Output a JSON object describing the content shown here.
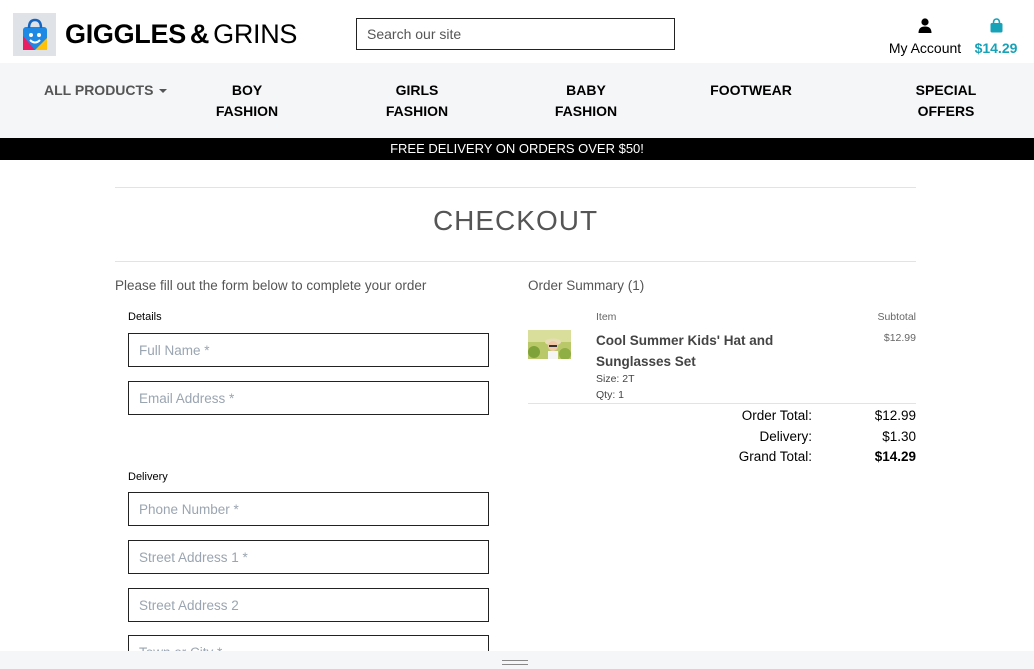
{
  "header": {
    "logo_text_bold": "GIGGLES",
    "logo_amp": "&",
    "logo_text_light": "GRINS",
    "search_placeholder": "Search our site",
    "account_label": "My Account",
    "account_icon": "user-icon",
    "cart_icon": "shopping-bag-icon",
    "cart_total": "$14.29",
    "accent_color": "#17a2b8"
  },
  "nav": {
    "all_products": "ALL PRODUCTS",
    "items": [
      {
        "line1": "BOY",
        "line2": "FASHION"
      },
      {
        "line1": "GIRLS",
        "line2": "FASHION"
      },
      {
        "line1": "BABY",
        "line2": "FASHION"
      },
      {
        "line1": "FOOTWEAR",
        "line2": ""
      },
      {
        "line1": "SPECIAL",
        "line2": "OFFERS"
      }
    ]
  },
  "banner": {
    "text": "FREE DELIVERY ON ORDERS OVER $50!"
  },
  "checkout": {
    "title": "CHECKOUT",
    "intro": "Please fill out the form below to complete your order",
    "details_label": "Details",
    "delivery_label": "Delivery",
    "placeholders": {
      "full_name": "Full Name *",
      "email": "Email Address *",
      "phone": "Phone Number *",
      "street1": "Street Address 1 *",
      "street2": "Street Address 2",
      "town": "Town or City *"
    }
  },
  "summary": {
    "title": "Order Summary (1)",
    "col_item": "Item",
    "col_subtotal": "Subtotal",
    "item": {
      "name": "Cool Summer Kids' Hat and Sunglasses Set",
      "size": "Size: 2T",
      "qty": "Qty: 1",
      "price": "$12.99"
    },
    "totals": {
      "order_total_label": "Order Total:",
      "order_total": "$12.99",
      "delivery_label": "Delivery:",
      "delivery": "$1.30",
      "grand_total_label": "Grand Total:",
      "grand_total": "$14.29"
    }
  }
}
